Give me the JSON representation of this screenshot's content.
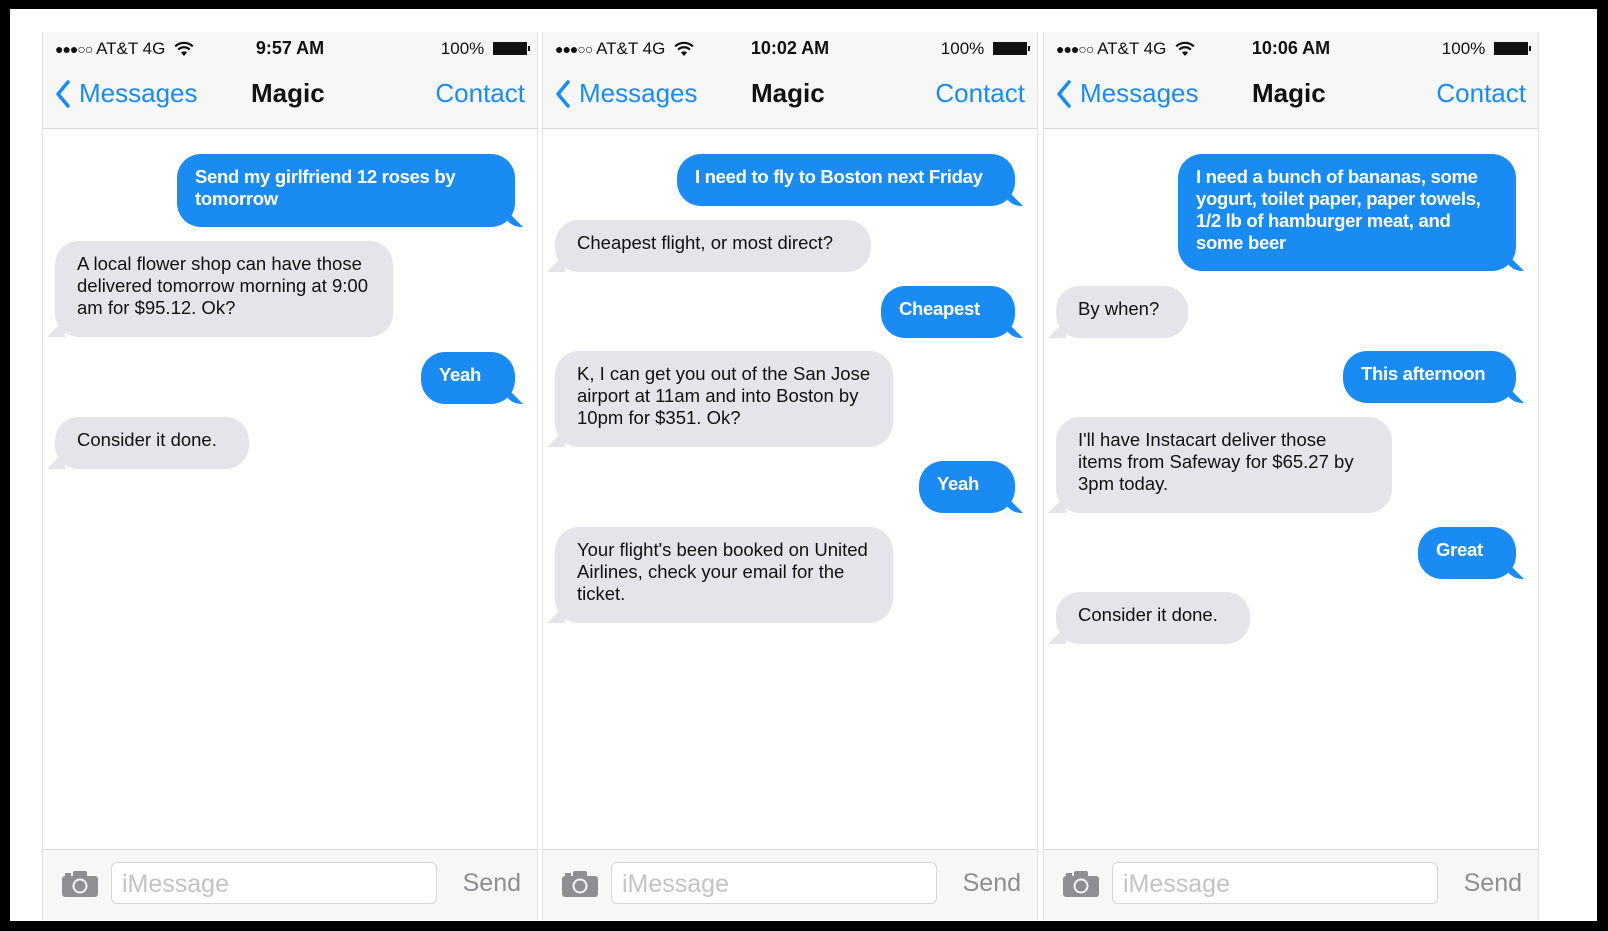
{
  "phones": [
    {
      "status": {
        "carrier": "AT&T 4G",
        "time": "9:57 AM",
        "battery": "100%"
      },
      "nav": {
        "back": "Messages",
        "title": "Magic",
        "contact": "Contact"
      },
      "messages": [
        {
          "from": "me",
          "text": "Send my girlfriend 12 roses by tomorrow"
        },
        {
          "from": "them",
          "text": "A local flower shop can have those delivered tomorrow morning at 9:00 am for $95.12. Ok?"
        },
        {
          "from": "me",
          "text": "Yeah"
        },
        {
          "from": "them",
          "text": "Consider it done."
        }
      ],
      "input": {
        "placeholder": "iMessage",
        "send": "Send"
      }
    },
    {
      "status": {
        "carrier": "AT&T 4G",
        "time": "10:02 AM",
        "battery": "100%"
      },
      "nav": {
        "back": "Messages",
        "title": "Magic",
        "contact": "Contact"
      },
      "messages": [
        {
          "from": "me",
          "text": "I need to fly to Boston next Friday"
        },
        {
          "from": "them",
          "text": "Cheapest flight, or most direct?"
        },
        {
          "from": "me",
          "text": "Cheapest"
        },
        {
          "from": "them",
          "text": "K, I can get you out of the San Jose airport at 11am and into Boston by 10pm for $351. Ok?"
        },
        {
          "from": "me",
          "text": "Yeah"
        },
        {
          "from": "them",
          "text": "Your flight's been booked on United Airlines, check your email for the ticket."
        }
      ],
      "input": {
        "placeholder": "iMessage",
        "send": "Send"
      }
    },
    {
      "status": {
        "carrier": "AT&T 4G",
        "time": "10:06 AM",
        "battery": "100%"
      },
      "nav": {
        "back": "Messages",
        "title": "Magic",
        "contact": "Contact"
      },
      "messages": [
        {
          "from": "me",
          "text": "I need a bunch of bananas, some yogurt, toilet paper, paper towels, 1/2 lb of hamburger meat, and some beer"
        },
        {
          "from": "them",
          "text": "By when?"
        },
        {
          "from": "me",
          "text": "This afternoon"
        },
        {
          "from": "them",
          "text": "I'll have Instacart deliver those items from Safeway for $65.27 by 3pm today."
        },
        {
          "from": "me",
          "text": "Great"
        },
        {
          "from": "them",
          "text": "Consider it done."
        }
      ],
      "input": {
        "placeholder": "iMessage",
        "send": "Send"
      }
    }
  ],
  "colors": {
    "accent": "#1a8bf3",
    "incoming_bubble": "#e4e4ea",
    "bar_bg": "#f7f7f7"
  }
}
